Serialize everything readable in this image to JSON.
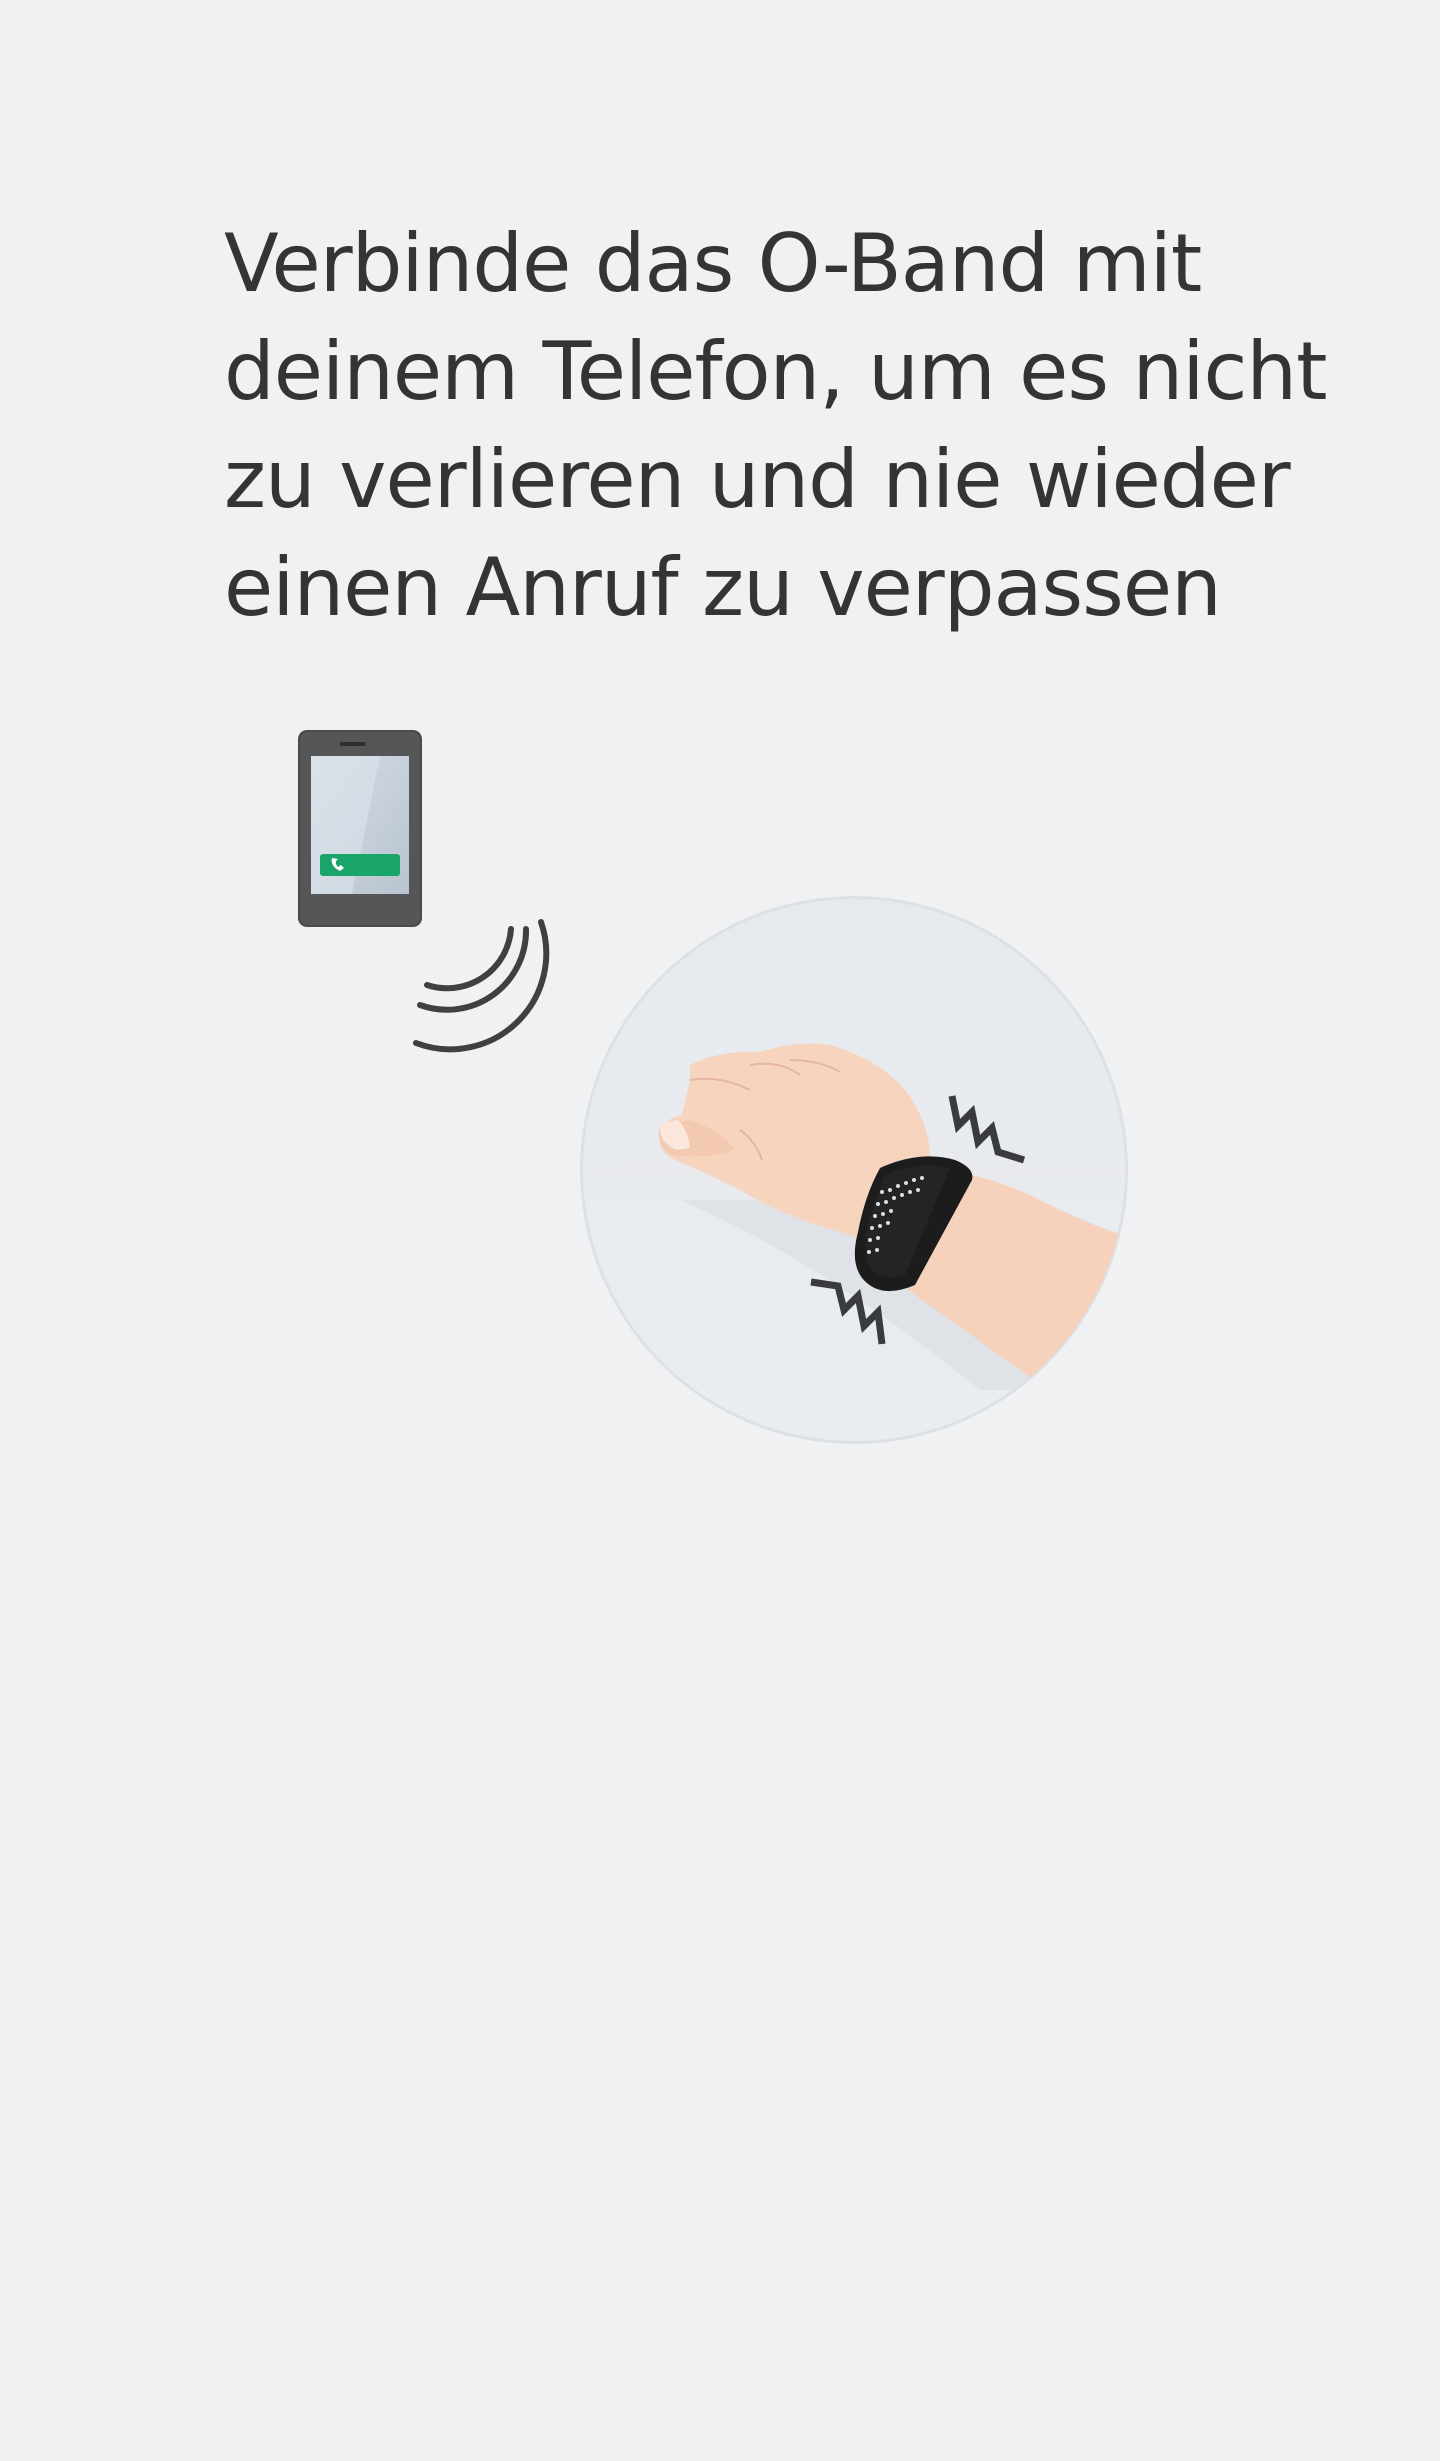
{
  "onboarding": {
    "headline_lines": [
      "Verbinde das O-Band mit",
      "deinem Telefon, um es nicht",
      "zu verlieren und nie wieder",
      "einen Anruf zu verpassen"
    ]
  },
  "illustration": {
    "phone_icon": "phone-icon",
    "call_button_icon": "phone-handset-icon",
    "signal_icon": "signal-waves-icon",
    "hand_icon": "hand-with-band-icon",
    "vibration_icon": "vibration-zigzag-icon",
    "accent_color": "#1aa56b",
    "band_color": "#1c1c1c"
  }
}
